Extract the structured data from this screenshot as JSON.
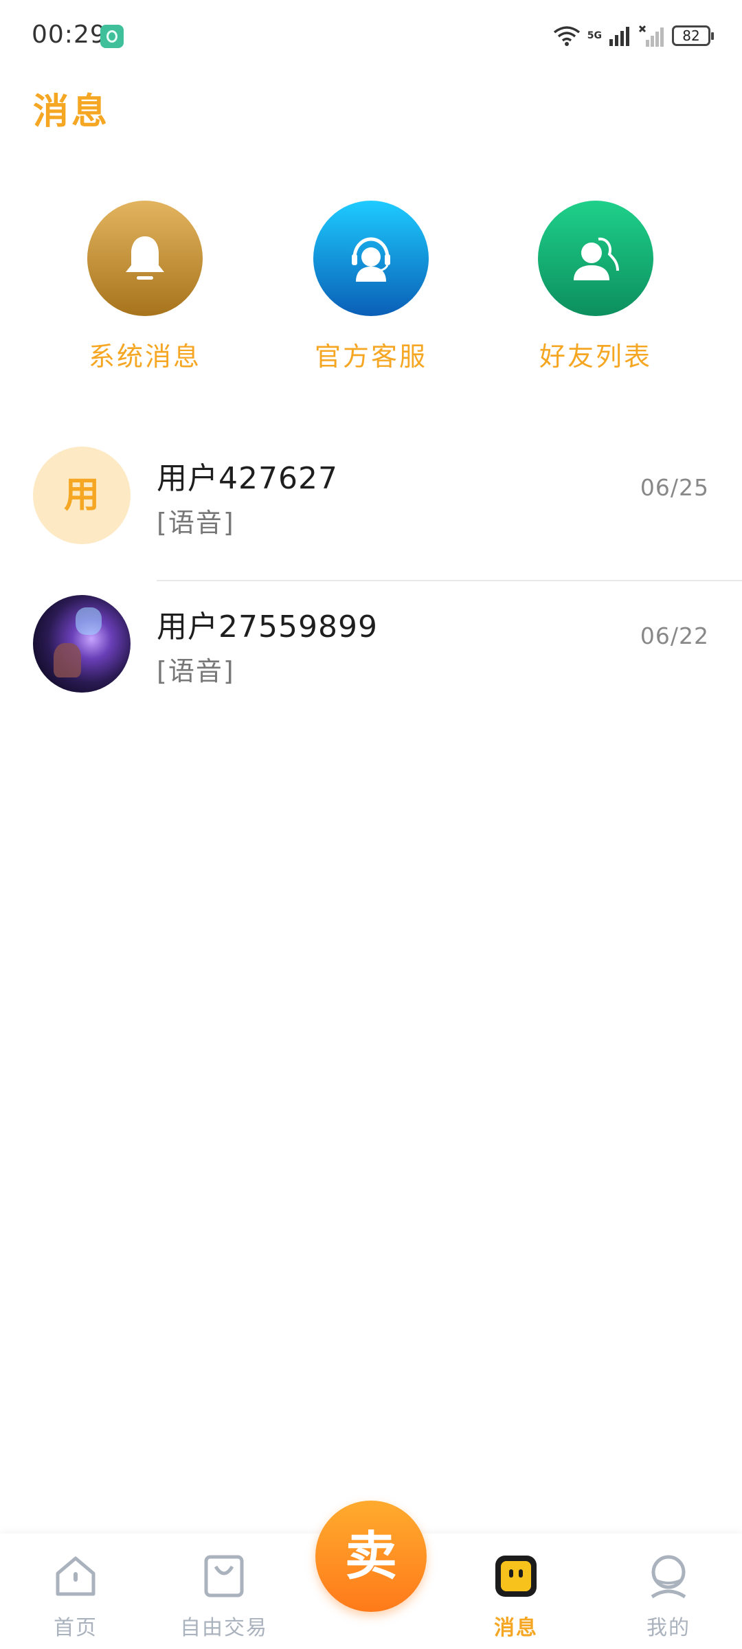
{
  "status_bar": {
    "time": "00:29",
    "network": "5G",
    "battery": "82"
  },
  "header": {
    "title": "消息"
  },
  "quick_entries": [
    {
      "label": "系统消息",
      "icon": "bell-icon",
      "color": "#c08a2e"
    },
    {
      "label": "官方客服",
      "icon": "headset-agent-icon",
      "color": "#0a8fd8"
    },
    {
      "label": "好友列表",
      "icon": "friends-icon",
      "color": "#10b374"
    }
  ],
  "chats": [
    {
      "name": "用户427627",
      "preview": "[语音]",
      "date": "06/25",
      "avatar_text": "用"
    },
    {
      "name": "用户27559899",
      "preview": "[语音]",
      "date": "06/22",
      "avatar_text": ""
    }
  ],
  "bottom_nav": {
    "items": [
      {
        "label": "首页",
        "icon": "home-icon"
      },
      {
        "label": "自由交易",
        "icon": "shopping-bag-icon"
      },
      {
        "label": "消息",
        "icon": "message-icon",
        "active": true
      },
      {
        "label": "我的",
        "icon": "profile-icon"
      }
    ],
    "sell_label": "卖"
  },
  "colors": {
    "accent": "#f5a623",
    "sell_button": "#ff8a1e",
    "inactive": "#aab2bd"
  }
}
